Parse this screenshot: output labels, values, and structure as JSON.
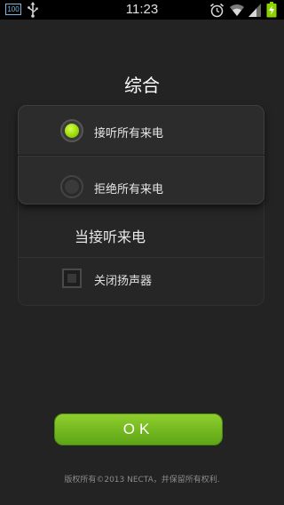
{
  "status_bar": {
    "battery_level_small": "100",
    "time": "11:23",
    "icons": [
      "battery-small-icon",
      "usb-icon",
      "alarm-icon",
      "wifi-icon",
      "signal-icon",
      "charging-battery-icon"
    ]
  },
  "title": "综合",
  "answer_options": {
    "items": [
      {
        "label": "接听所有来电",
        "selected": true
      },
      {
        "label": "拒绝所有来电",
        "selected": false
      }
    ]
  },
  "on_answer": {
    "heading": "当接听来电",
    "speaker_checkbox": {
      "label": "关闭扬声器",
      "checked": false
    }
  },
  "ok_button": {
    "label": "OK"
  },
  "footer": {
    "copyright": "版权所有©2013 NECTA，并保留所有权利."
  },
  "colors": {
    "accent_green": "#8cd100",
    "background": "#232323",
    "button_green": "#6fb51f"
  }
}
